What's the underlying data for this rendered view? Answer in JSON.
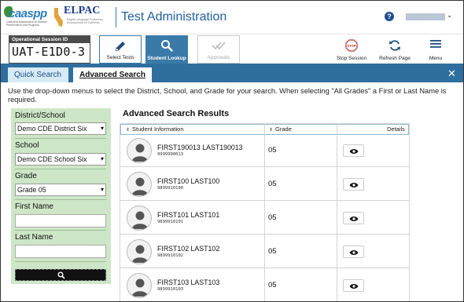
{
  "header": {
    "caaspp_logo_text": "caaspp",
    "caaspp_logo_sub": "California Assessment of Student Performance and Progress",
    "elpac_logo_text": "ELPAC",
    "elpac_logo_sub": "English Language Proficiency Assessments for California",
    "app_title": "Test Administration",
    "help_label": "?",
    "user_menu_chevron": "⌄"
  },
  "toolbar": {
    "session_label": "Operational Session ID",
    "session_id": "UAT-E1D0-3",
    "select_tests": "Select Tests",
    "student_lookup": "Student Lookup",
    "approvals": "Approvals",
    "stop_session": "Stop Session",
    "refresh_page": "Refresh Page",
    "menu": "Menu"
  },
  "tabs": {
    "quick": "Quick Search",
    "advanced": "Advanced Search",
    "close": "✕"
  },
  "instructions": "Use the drop-down menus to select the District, School, and Grade for your search. When selecting \"All Grades\" a First or Last Name is required.",
  "filters": {
    "district_label": "District/School",
    "district_value": "Demo CDE District Six",
    "school_label": "School",
    "school_value": "Demo CDE School Six",
    "grade_label": "Grade",
    "grade_value": "Grade 05",
    "first_name_label": "First Name",
    "first_name_value": "",
    "last_name_label": "Last Name",
    "last_name_value": ""
  },
  "results": {
    "title": "Advanced Search Results",
    "columns": [
      "Student Information",
      "Grade",
      "Details"
    ],
    "rows": [
      {
        "name": "FIRST190013 LAST190013",
        "ssid": "9999990013",
        "grade": "05"
      },
      {
        "name": "FIRST100 LAST100",
        "ssid": "9899910100",
        "grade": "05"
      },
      {
        "name": "FIRST101 LAST101",
        "ssid": "9899910101",
        "grade": "05"
      },
      {
        "name": "FIRST102 LAST102",
        "ssid": "9899910102",
        "grade": "05"
      },
      {
        "name": "FIRST103 LAST103",
        "ssid": "9899910103",
        "grade": "05"
      }
    ]
  },
  "colors": {
    "primary_blue": "#3a7aa8",
    "tabbar_blue": "#2f6f9f",
    "filter_green": "#cde6c7",
    "title_blue": "#1f5fa0"
  }
}
